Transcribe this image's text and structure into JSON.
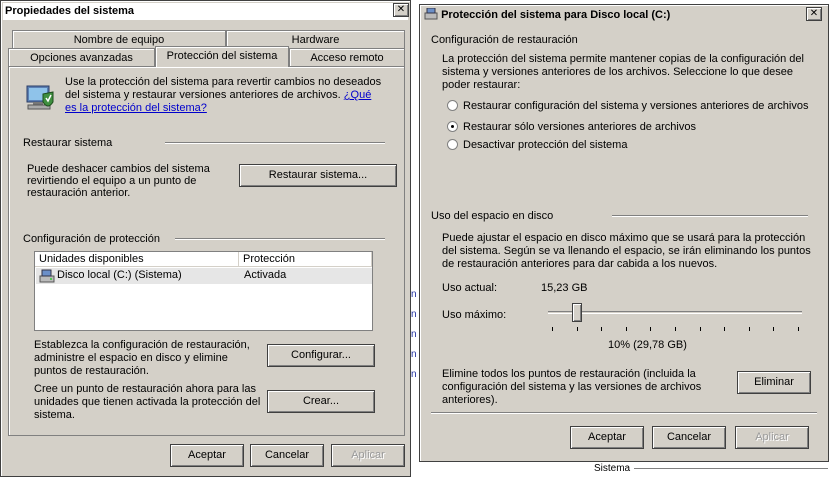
{
  "left": {
    "title": "Propiedades del sistema",
    "close_glyph": "✕",
    "tabs_row1": [
      "Nombre de equipo",
      "Hardware"
    ],
    "tabs_row2": [
      "Opciones avanzadas",
      "Protección del sistema",
      "Acceso remoto"
    ],
    "intro_text": "Use la protección del sistema para revertir cambios no deseados del sistema y restaurar versiones anteriores de archivos.",
    "intro_link": "¿Qué es la protección del sistema?",
    "restore_heading": "Restaurar sistema",
    "restore_desc": "Puede deshacer cambios del sistema revirtiendo el equipo a un punto de restauración anterior.",
    "restore_button": "Restaurar sistema...",
    "protection_heading": "Configuración de protección",
    "table_headers": [
      "Unidades disponibles",
      "Protección"
    ],
    "table_rows": [
      {
        "drive": "Disco local (C:) (Sistema)",
        "status": "Activada"
      }
    ],
    "configure_desc": "Establezca la configuración de restauración, administre el espacio en disco y elimine puntos de restauración.",
    "configure_button": "Configurar...",
    "create_desc": "Cree un punto de restauración ahora para las unidades que tienen activada la protección del sistema.",
    "create_button": "Crear...",
    "ok_button": "Aceptar",
    "cancel_button": "Cancelar",
    "apply_button": "Aplicar"
  },
  "right": {
    "title": "Protección del sistema para Disco local (C:)",
    "close_glyph": "✕",
    "restore_config_heading": "Configuración de restauración",
    "restore_config_desc": "La protección del sistema permite mantener copias de la configuración del sistema y versiones anteriores de los archivos. Seleccione lo que desee poder restaurar:",
    "options": [
      {
        "label": "Restaurar configuración del sistema y versiones anteriores de archivos",
        "selected": false
      },
      {
        "label": "Restaurar sólo versiones anteriores de archivos",
        "selected": true
      },
      {
        "label": "Desactivar protección del sistema",
        "selected": false
      }
    ],
    "disk_heading": "Uso del espacio en disco",
    "disk_desc": "Puede ajustar el espacio en disco máximo que se usará para la protección del sistema. Según se va llenando el espacio, se irán eliminando los puntos de restauración anteriores para dar cabida a los nuevos.",
    "current_label": "Uso actual:",
    "current_value": "15,23 GB",
    "max_label": "Uso máximo:",
    "slider_percent": 10,
    "slider_readout": "10% (29,78 GB)",
    "delete_desc": "Elimine todos los puntos de restauración (incluida la configuración del sistema y las versiones de archivos anteriores).",
    "delete_button": "Eliminar",
    "ok_button": "Aceptar",
    "cancel_button": "Cancelar",
    "apply_button": "Aplicar"
  },
  "background": {
    "sistema_label": "Sistema"
  },
  "colors": {
    "dialog_face": "#d4d0c8",
    "link": "#0000cc"
  }
}
